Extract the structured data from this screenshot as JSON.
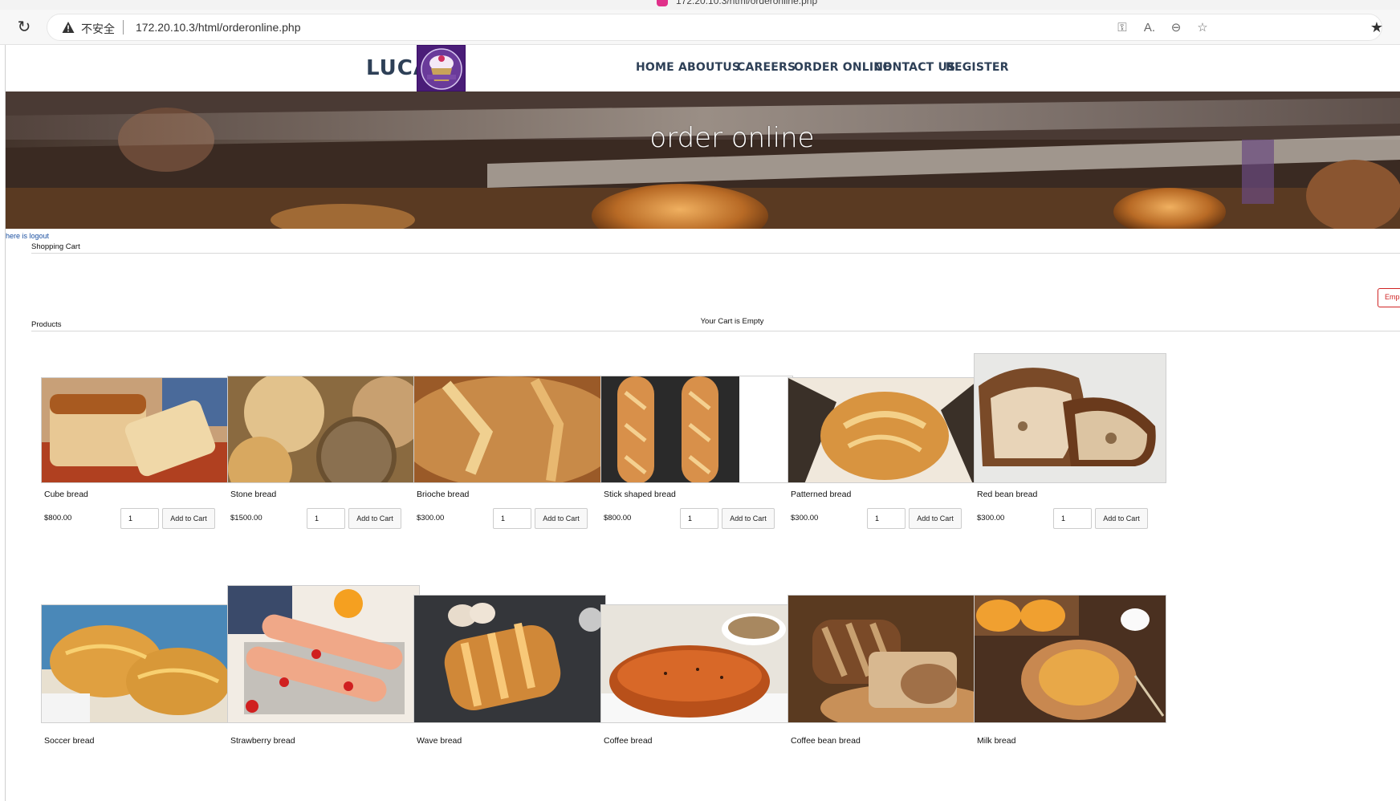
{
  "browser": {
    "tab_title": "172.20.10.3/html/orderonline.php",
    "insecure_label": "不安全",
    "url": "172.20.10.3/html/orderonline.php"
  },
  "site": {
    "brand": "LUCA",
    "nav": [
      "HOME",
      "ABOUTUS",
      "CAREERS",
      "ORDER ONLINE",
      "CONTACT US",
      "REGISTER"
    ],
    "hero_title": "order online",
    "logout_link": "here is logout"
  },
  "cart": {
    "heading": "Shopping Cart",
    "empty_button": "Emp",
    "empty_message": "Your Cart is Empty"
  },
  "products_heading": "Products",
  "products": [
    {
      "name": "Cube bread",
      "price": "$800.00",
      "qty": "1",
      "button": "Add to Cart"
    },
    {
      "name": "Stone bread",
      "price": "$1500.00",
      "qty": "1",
      "button": "Add to Cart"
    },
    {
      "name": "Brioche bread",
      "price": "$300.00",
      "qty": "1",
      "button": "Add to Cart"
    },
    {
      "name": "Stick shaped bread",
      "price": "$800.00",
      "qty": "1",
      "button": "Add to Cart"
    },
    {
      "name": "Patterned bread",
      "price": "$300.00",
      "qty": "1",
      "button": "Add to Cart"
    },
    {
      "name": "Red bean bread",
      "price": "$300.00",
      "qty": "1",
      "button": "Add to Cart"
    },
    {
      "name": "Soccer bread"
    },
    {
      "name": "Strawberry bread"
    },
    {
      "name": "Wave bread"
    },
    {
      "name": "Coffee bread"
    },
    {
      "name": "Coffee bean bread"
    },
    {
      "name": "Milk bread"
    }
  ]
}
